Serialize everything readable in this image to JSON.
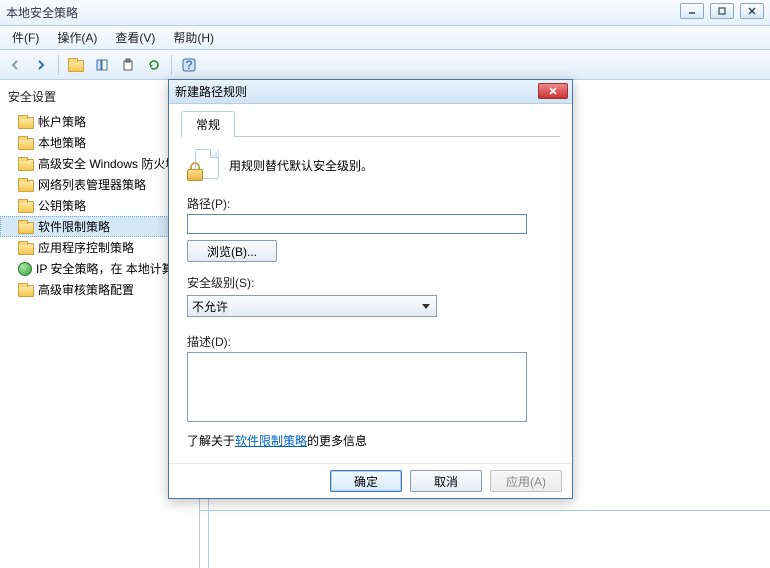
{
  "window": {
    "title": "本地安全策略"
  },
  "menu": {
    "file": "件(F)",
    "action": "操作(A)",
    "view": "查看(V)",
    "help": "帮助(H)"
  },
  "tree": {
    "header": "安全设置",
    "items": [
      {
        "label": "帐户策略"
      },
      {
        "label": "本地策略"
      },
      {
        "label": "高级安全 Windows 防火墙"
      },
      {
        "label": "网络列表管理器策略"
      },
      {
        "label": "公钥策略"
      },
      {
        "label": "软件限制策略",
        "selected": true
      },
      {
        "label": "应用程序控制策略"
      },
      {
        "label": "IP 安全策略，在 本地计算",
        "icon": "globe"
      },
      {
        "label": "高级审核策略配置"
      }
    ]
  },
  "dialog": {
    "title": "新建路径规则",
    "tab": "常规",
    "desc": "用规则替代默认安全级别。",
    "path_label": "路径(P):",
    "path_value": "",
    "browse": "浏览(B)...",
    "sec_label": "安全级别(S):",
    "sec_value": "不允许",
    "desc_label": "描述(D):",
    "desc_value": "",
    "learn_prefix": "了解关于",
    "learn_link": "软件限制策略",
    "learn_suffix": "的更多信息",
    "ok": "确定",
    "cancel": "取消",
    "apply": "应用(A)"
  }
}
